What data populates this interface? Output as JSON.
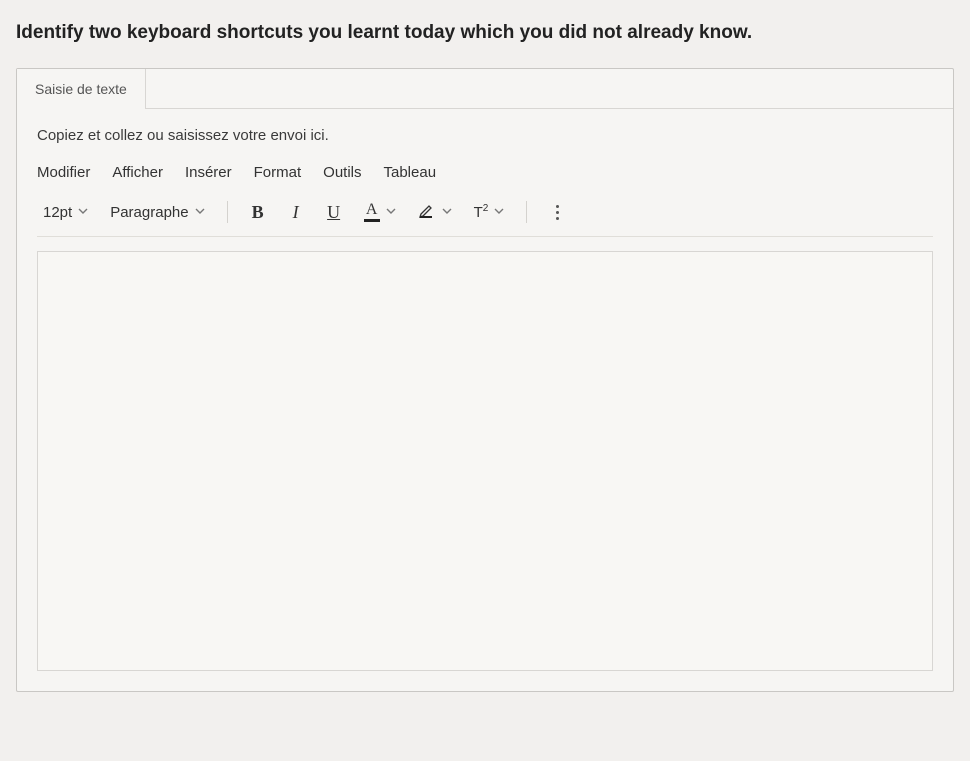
{
  "question": "Identify two keyboard shortcuts you learnt today which you did not already know.",
  "tab_label": "Saisie de texte",
  "hint": "Copiez et collez ou saisissez votre envoi ici.",
  "menubar": {
    "modifier": "Modifier",
    "afficher": "Afficher",
    "inserer": "Insérer",
    "format": "Format",
    "outils": "Outils",
    "tableau": "Tableau"
  },
  "toolbar": {
    "font_size": "12pt",
    "block_format": "Paragraphe",
    "bold": "B",
    "italic": "I",
    "underline": "U",
    "text_color_letter": "A",
    "superscript": "T",
    "superscript_exp": "2"
  },
  "editor_value": ""
}
